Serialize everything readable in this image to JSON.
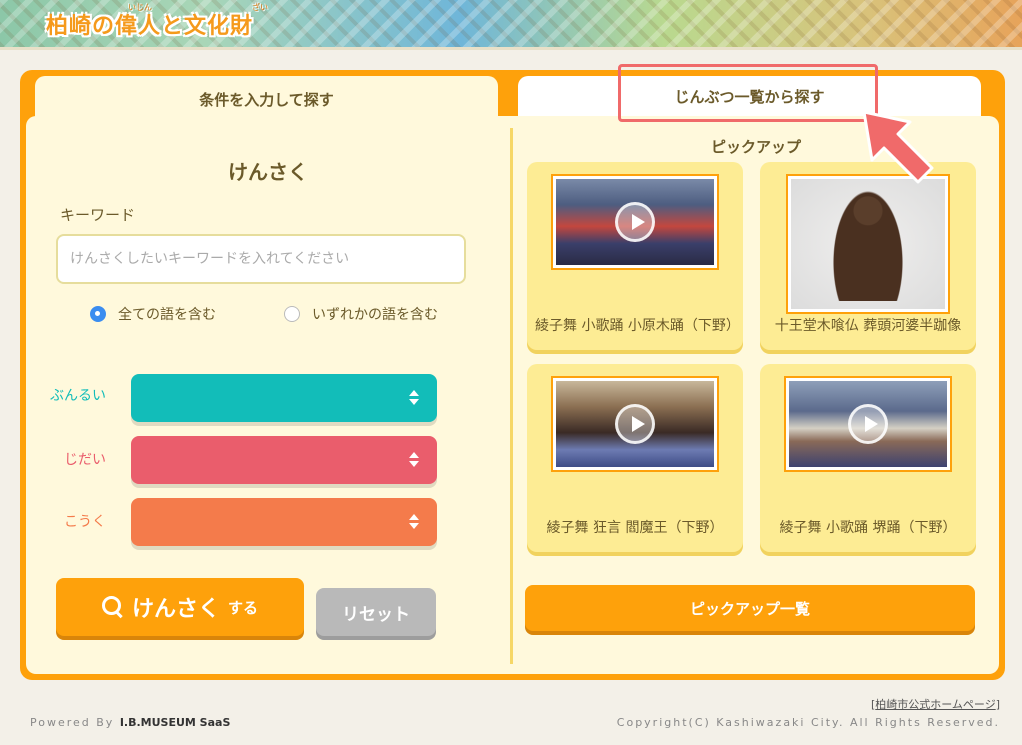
{
  "header": {
    "logo_text": "柏崎の偉人と文化財",
    "logo_ruby_1": "いじん",
    "logo_ruby_2": "ざい"
  },
  "tabs": {
    "search_label": "条件を入力して探す",
    "list_label": "じんぶつ一覧から探す"
  },
  "search": {
    "heading": "けんさく",
    "keyword_label": "キーワード",
    "keyword_placeholder": "けんさくしたいキーワードを入れてください",
    "keyword_value": "",
    "radio_all_label": "全ての語を含む",
    "radio_any_label": "いずれかの語を含む",
    "radio_selected": "all",
    "genre_label": "ぶんるい",
    "genre_color": "#12bdb9",
    "era_label": "じだい",
    "era_color": "#ea5d6c",
    "region_label": "こうく",
    "region_color": "#f47b4b",
    "search_button_main": "けんさく",
    "search_button_suffix": "する",
    "reset_button": "リセット"
  },
  "pickup": {
    "heading": "ピックアップ",
    "items": [
      {
        "title": "綾子舞 小歌踊 小原木踊（下野）",
        "media": "video"
      },
      {
        "title": "十王堂木喰仏 葬頭河婆半跏像",
        "media": "image"
      },
      {
        "title": "綾子舞 狂言 閻魔王（下野）",
        "media": "video"
      },
      {
        "title": "綾子舞 小歌踊 堺踊（下野）",
        "media": "video"
      }
    ],
    "list_button": "ピックアップ一覧"
  },
  "annotation": {
    "highlight_color": "#f06a6a"
  },
  "footer": {
    "official_link": "柏崎市公式ホームページ",
    "powered_prefix": "Powered By",
    "powered_brand": "I.B.MUSEUM SaaS",
    "copyright": "Copyright(C) Kashiwazaki City. All Rights Reserved."
  },
  "colors": {
    "accent_orange": "#fea10b",
    "panel_bg": "#fff9dc",
    "card_bg": "#fdec94",
    "text_brown": "#6b5a2a"
  }
}
